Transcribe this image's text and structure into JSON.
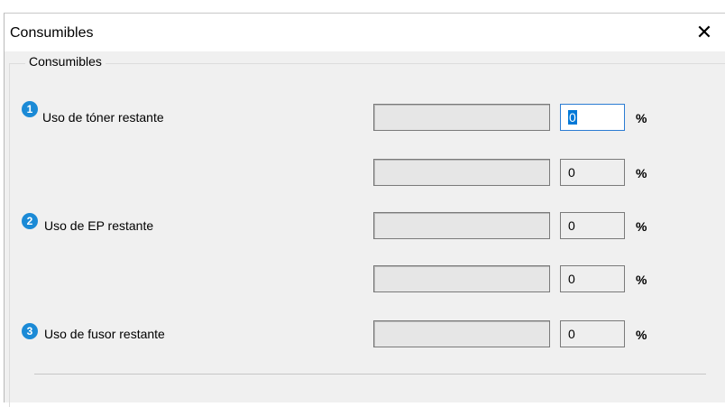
{
  "window": {
    "title": "Consumibles",
    "close_glyph": "✕"
  },
  "group": {
    "legend": "Consumibles"
  },
  "rows": [
    {
      "badge": "1",
      "label": "Uso de tóner restante",
      "value": "0",
      "unit": "%",
      "level": 0
    },
    {
      "label": "",
      "value": "0",
      "unit": "%",
      "level": 0
    },
    {
      "badge": "2",
      "label": "Uso de EP restante",
      "value": "0",
      "unit": "%",
      "level": 0
    },
    {
      "label": "",
      "value": "0",
      "unit": "%",
      "level": 0
    },
    {
      "badge": "3",
      "label": "Uso de fusor restante",
      "value": "0",
      "unit": "%",
      "level": 0
    }
  ],
  "colors": {
    "badge": "#1b8ad6",
    "selection": "#0078d7"
  }
}
